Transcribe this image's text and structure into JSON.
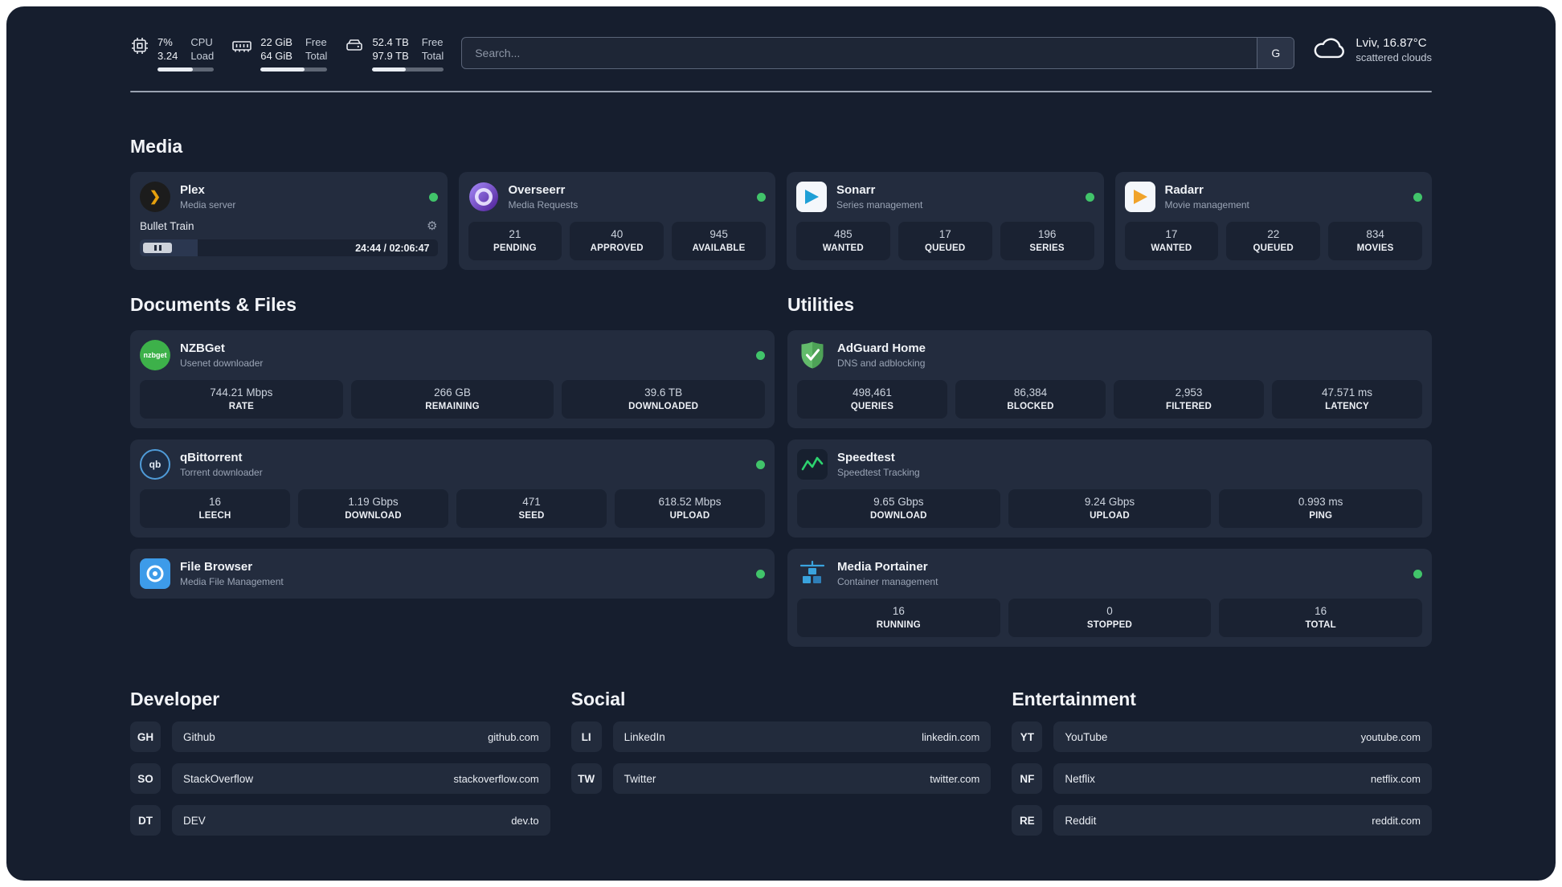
{
  "colors": {
    "background": "#161e2e",
    "card": "#232c3e",
    "stat_box": "#1a2232",
    "status_green": "#41c46a",
    "plex_accent": "#e5a00d"
  },
  "topbar": {
    "cpu": {
      "value_top": "7%",
      "value_bottom": "3.24",
      "label_top": "CPU",
      "label_bottom": "Load",
      "bar_percent": 62
    },
    "ram": {
      "value_top": "22 GiB",
      "value_bottom": "64 GiB",
      "label_top": "Free",
      "label_bottom": "Total",
      "bar_percent": 66
    },
    "disk": {
      "value_top": "52.4 TB",
      "value_bottom": "97.9 TB",
      "label_top": "Free",
      "label_bottom": "Total",
      "bar_percent": 47
    },
    "search": {
      "placeholder": "Search...",
      "button_label": "G"
    },
    "weather": {
      "location": "Lviv, 16.87°C",
      "condition": "scattered clouds"
    }
  },
  "media": {
    "title": "Media",
    "plex": {
      "name": "Plex",
      "subtitle": "Media server",
      "now_playing": "Bullet Train",
      "time": "24:44 / 02:06:47",
      "progress_percent": 19.5
    },
    "overseerr": {
      "name": "Overseerr",
      "subtitle": "Media Requests",
      "stats": [
        {
          "value": "21",
          "label": "PENDING"
        },
        {
          "value": "40",
          "label": "APPROVED"
        },
        {
          "value": "945",
          "label": "AVAILABLE"
        }
      ]
    },
    "sonarr": {
      "name": "Sonarr",
      "subtitle": "Series management",
      "stats": [
        {
          "value": "485",
          "label": "WANTED"
        },
        {
          "value": "17",
          "label": "QUEUED"
        },
        {
          "value": "196",
          "label": "SERIES"
        }
      ]
    },
    "radarr": {
      "name": "Radarr",
      "subtitle": "Movie management",
      "stats": [
        {
          "value": "17",
          "label": "WANTED"
        },
        {
          "value": "22",
          "label": "QUEUED"
        },
        {
          "value": "834",
          "label": "MOVIES"
        }
      ]
    }
  },
  "documents": {
    "title": "Documents & Files",
    "nzbget": {
      "name": "NZBGet",
      "subtitle": "Usenet downloader",
      "icon_text": "nzbget",
      "stats": [
        {
          "value": "744.21 Mbps",
          "label": "RATE"
        },
        {
          "value": "266 GB",
          "label": "REMAINING"
        },
        {
          "value": "39.6 TB",
          "label": "DOWNLOADED"
        }
      ]
    },
    "qbittorrent": {
      "name": "qBittorrent",
      "subtitle": "Torrent downloader",
      "icon_text": "qb",
      "stats": [
        {
          "value": "16",
          "label": "LEECH"
        },
        {
          "value": "1.19 Gbps",
          "label": "DOWNLOAD"
        },
        {
          "value": "471",
          "label": "SEED"
        },
        {
          "value": "618.52 Mbps",
          "label": "UPLOAD"
        }
      ]
    },
    "filebrowser": {
      "name": "File Browser",
      "subtitle": "Media File Management"
    }
  },
  "utilities": {
    "title": "Utilities",
    "adguard": {
      "name": "AdGuard Home",
      "subtitle": "DNS and adblocking",
      "stats": [
        {
          "value": "498,461",
          "label": "QUERIES"
        },
        {
          "value": "86,384",
          "label": "BLOCKED"
        },
        {
          "value": "2,953",
          "label": "FILTERED"
        },
        {
          "value": "47.571 ms",
          "label": "LATENCY"
        }
      ]
    },
    "speedtest": {
      "name": "Speedtest",
      "subtitle": "Speedtest Tracking",
      "stats": [
        {
          "value": "9.65 Gbps",
          "label": "DOWNLOAD"
        },
        {
          "value": "9.24 Gbps",
          "label": "UPLOAD"
        },
        {
          "value": "0.993 ms",
          "label": "PING"
        }
      ]
    },
    "portainer": {
      "name": "Media Portainer",
      "subtitle": "Container management",
      "stats": [
        {
          "value": "16",
          "label": "RUNNING"
        },
        {
          "value": "0",
          "label": "STOPPED"
        },
        {
          "value": "16",
          "label": "TOTAL"
        }
      ]
    }
  },
  "links": {
    "developer": {
      "title": "Developer",
      "items": [
        {
          "badge": "GH",
          "name": "Github",
          "url": "github.com"
        },
        {
          "badge": "SO",
          "name": "StackOverflow",
          "url": "stackoverflow.com"
        },
        {
          "badge": "DT",
          "name": "DEV",
          "url": "dev.to"
        }
      ]
    },
    "social": {
      "title": "Social",
      "items": [
        {
          "badge": "LI",
          "name": "LinkedIn",
          "url": "linkedin.com"
        },
        {
          "badge": "TW",
          "name": "Twitter",
          "url": "twitter.com"
        }
      ]
    },
    "entertainment": {
      "title": "Entertainment",
      "items": [
        {
          "badge": "YT",
          "name": "YouTube",
          "url": "youtube.com"
        },
        {
          "badge": "NF",
          "name": "Netflix",
          "url": "netflix.com"
        },
        {
          "badge": "RE",
          "name": "Reddit",
          "url": "reddit.com"
        }
      ]
    }
  }
}
